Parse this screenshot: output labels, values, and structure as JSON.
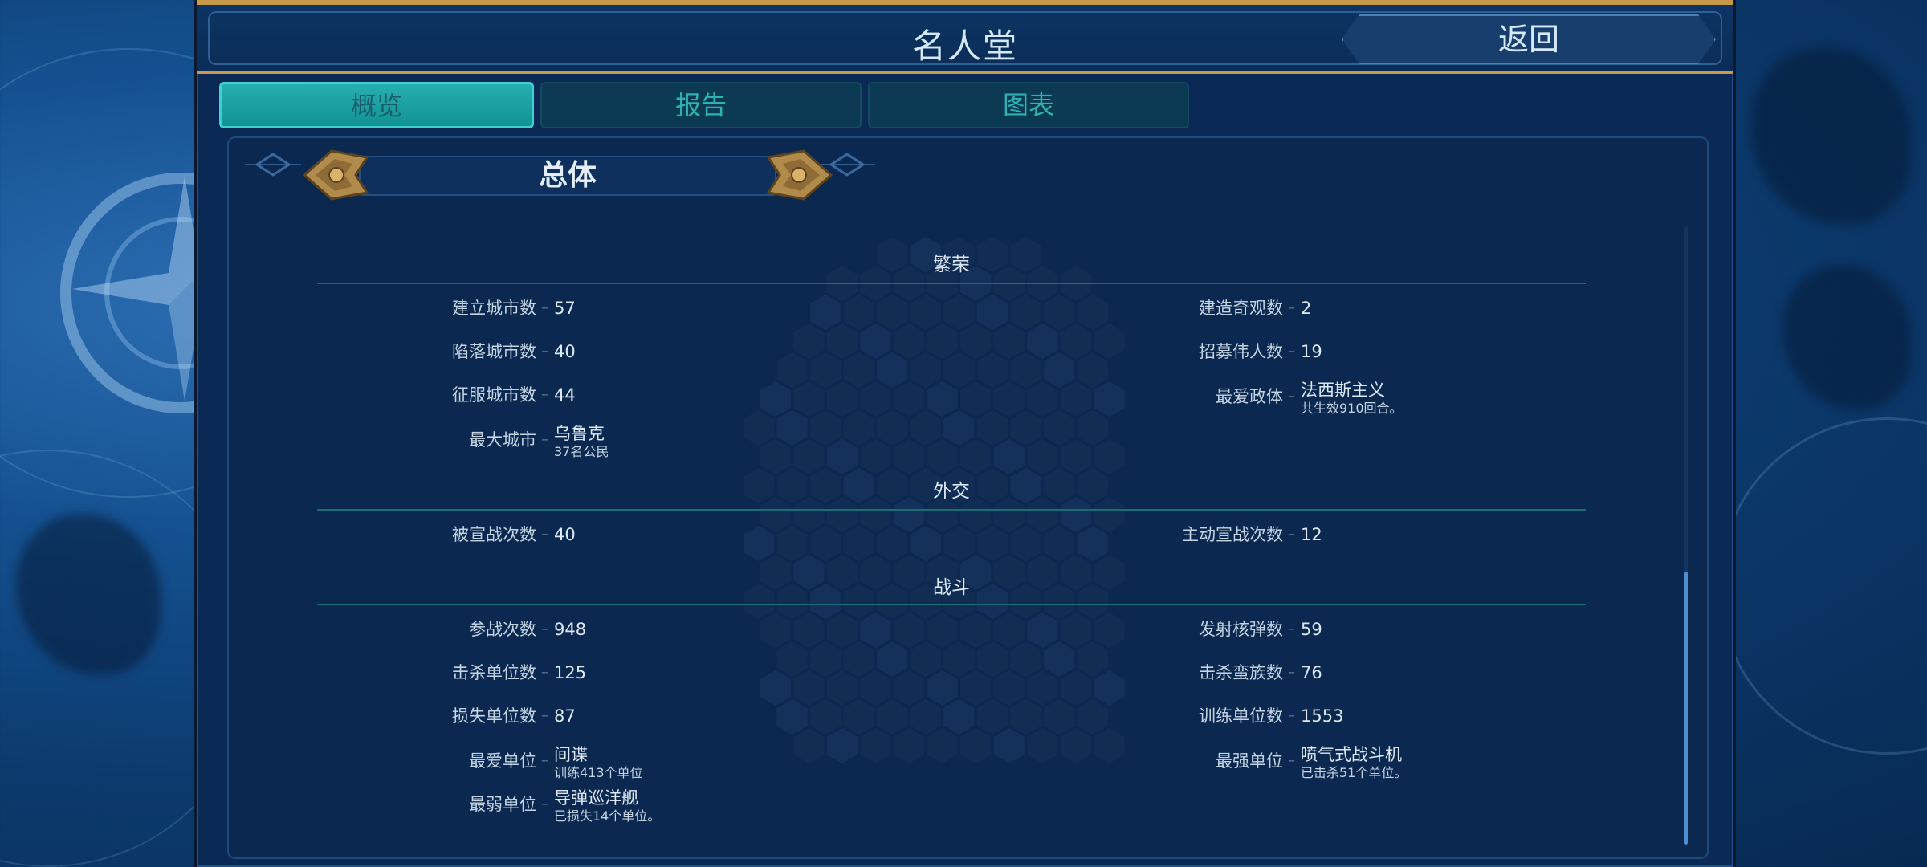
{
  "colors": {
    "gold": "#c69a4a",
    "teal_tab": "#1ba3a4",
    "panel": "#0b2850"
  },
  "header": {
    "title": "名人堂",
    "back_label": "返回"
  },
  "tabs": [
    {
      "label": "概览",
      "active": true
    },
    {
      "label": "报告",
      "active": false
    },
    {
      "label": "图表",
      "active": false
    }
  ],
  "category": {
    "label": "总体",
    "prev_icon": "arrow-left-icon",
    "next_icon": "arrow-right-icon"
  },
  "sections": {
    "prosperity": {
      "title": "繁荣",
      "stats": {
        "cities_founded": {
          "label": "建立城市数",
          "value": "57"
        },
        "cities_lost": {
          "label": "陷落城市数",
          "value": "40"
        },
        "cities_conquered": {
          "label": "征服城市数",
          "value": "44"
        },
        "largest_city": {
          "label": "最大城市",
          "value": "乌鲁克",
          "sub": "37名公民"
        },
        "wonders_built": {
          "label": "建造奇观数",
          "value": "2"
        },
        "great_people": {
          "label": "招募伟人数",
          "value": "19"
        },
        "favorite_government": {
          "label": "最爱政体",
          "value": "法西斯主义",
          "sub": "共生效910回合。"
        }
      }
    },
    "diplomacy": {
      "title": "外交",
      "stats": {
        "war_declared_on": {
          "label": "被宣战次数",
          "value": "40"
        },
        "wars_declared": {
          "label": "主动宣战次数",
          "value": "12"
        }
      }
    },
    "combat": {
      "title": "战斗",
      "stats": {
        "battles": {
          "label": "参战次数",
          "value": "948"
        },
        "units_killed": {
          "label": "击杀单位数",
          "value": "125"
        },
        "units_lost": {
          "label": "损失单位数",
          "value": "87"
        },
        "favorite_unit": {
          "label": "最爱单位",
          "value": "间谍",
          "sub": "训练413个单位"
        },
        "weakest_unit": {
          "label": "最弱单位",
          "value": "导弹巡洋舰",
          "sub": "已损失14个单位。"
        },
        "nukes_launched": {
          "label": "发射核弹数",
          "value": "59"
        },
        "barbarians_killed": {
          "label": "击杀蛮族数",
          "value": "76"
        },
        "units_trained": {
          "label": "训练单位数",
          "value": "1553"
        },
        "strongest_unit": {
          "label": "最强单位",
          "value": "喷气式战斗机",
          "sub": "已击杀51个单位。"
        }
      }
    }
  }
}
